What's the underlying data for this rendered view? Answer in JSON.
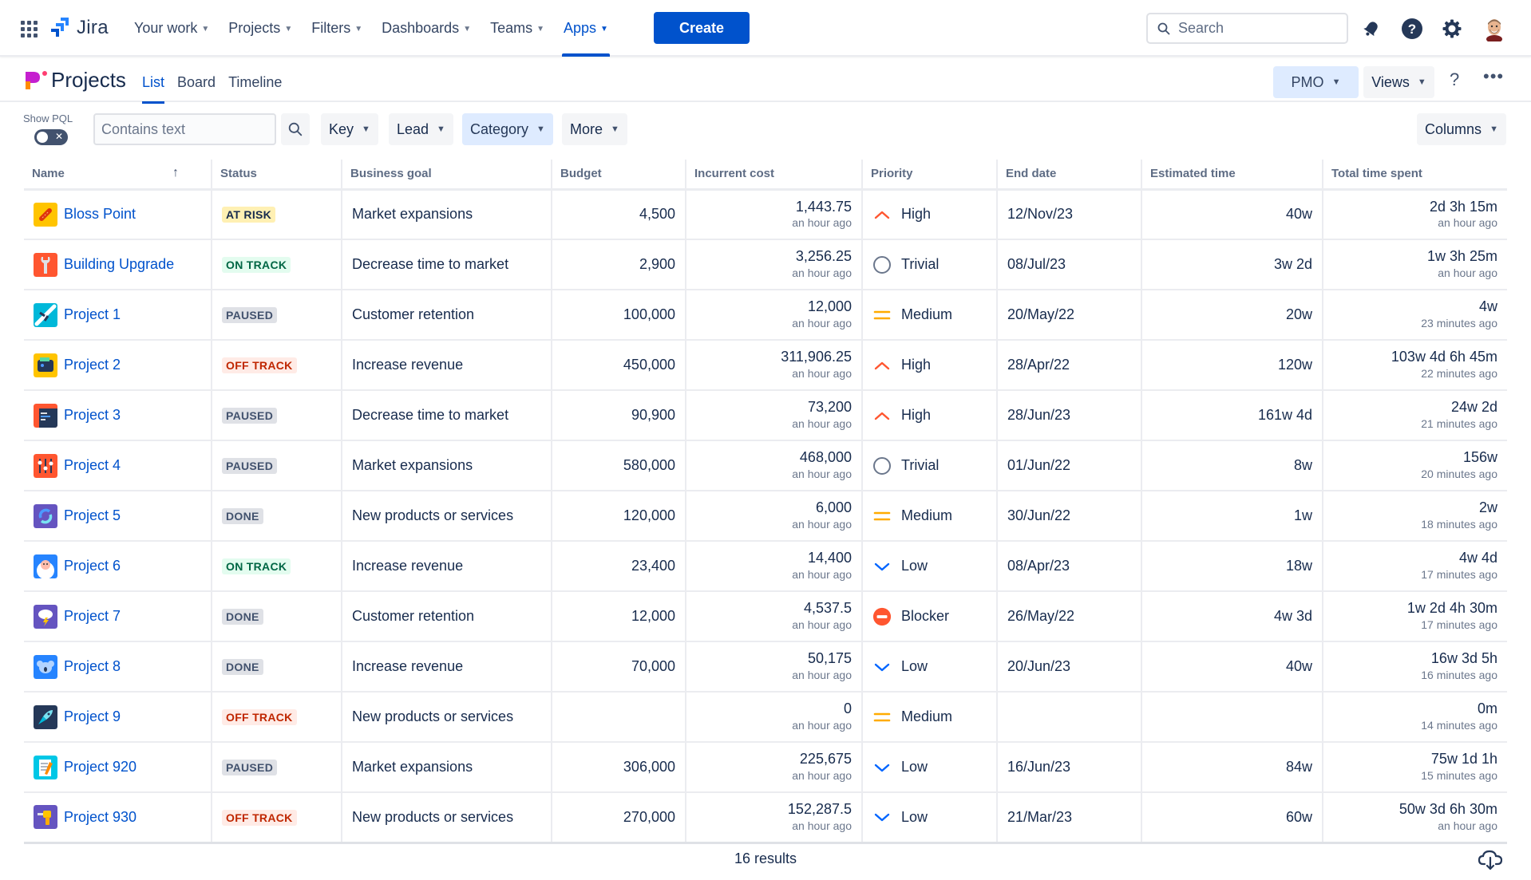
{
  "topnav": {
    "logo_text": "Jira",
    "items": [
      {
        "label": "Your work",
        "active": false
      },
      {
        "label": "Projects",
        "active": false
      },
      {
        "label": "Filters",
        "active": false
      },
      {
        "label": "Dashboards",
        "active": false
      },
      {
        "label": "Teams",
        "active": false
      },
      {
        "label": "Apps",
        "active": true
      }
    ],
    "create_label": "Create",
    "search_placeholder": "Search"
  },
  "subheader": {
    "title": "Projects",
    "tabs": [
      {
        "label": "List",
        "active": true
      },
      {
        "label": "Board",
        "active": false
      },
      {
        "label": "Timeline",
        "active": false
      }
    ],
    "pmo_label": "PMO",
    "views_label": "Views",
    "help_label": "?",
    "more_label": "•••"
  },
  "filters": {
    "show_pql_label": "Show PQL",
    "pql_enabled": false,
    "contains_placeholder": "Contains text",
    "contains_value": "",
    "buttons": [
      {
        "label": "Key",
        "selected": false
      },
      {
        "label": "Lead",
        "selected": false
      },
      {
        "label": "Category",
        "selected": true
      },
      {
        "label": "More",
        "selected": false
      }
    ],
    "columns_label": "Columns"
  },
  "table": {
    "columns": [
      "Name",
      "Status",
      "Business goal",
      "Budget",
      "Incurrent cost",
      "Priority",
      "End date",
      "Estimated time",
      "Total time spent"
    ],
    "sort": {
      "column": "Name",
      "direction": "ascending"
    },
    "rows": [
      {
        "name": "Bloss Point",
        "icon": "sausage-icon",
        "status": "AT RISK",
        "goal": "Market expansions",
        "budget": "4,500",
        "cost": "1,443.75",
        "cost_updated": "an hour ago",
        "priority": "High",
        "end_date": "12/Nov/23",
        "estimated": "40w",
        "spent": "2d 3h 15m",
        "spent_updated": "an hour ago"
      },
      {
        "name": "Building Upgrade",
        "icon": "wrench-icon",
        "status": "ON TRACK",
        "goal": "Decrease time to market",
        "budget": "2,900",
        "cost": "3,256.25",
        "cost_updated": "an hour ago",
        "priority": "Trivial",
        "end_date": "08/Jul/23",
        "estimated": "3w 2d",
        "spent": "1w 3h 25m",
        "spent_updated": "an hour ago"
      },
      {
        "name": "Project 1",
        "icon": "airplane-icon",
        "status": "PAUSED",
        "goal": "Customer retention",
        "budget": "100,000",
        "cost": "12,000",
        "cost_updated": "an hour ago",
        "priority": "Medium",
        "end_date": "20/May/22",
        "estimated": "20w",
        "spent": "4w",
        "spent_updated": "23 minutes ago"
      },
      {
        "name": "Project 2",
        "icon": "wallet-icon",
        "status": "OFF TRACK",
        "goal": "Increase revenue",
        "budget": "450,000",
        "cost": "311,906.25",
        "cost_updated": "an hour ago",
        "priority": "High",
        "end_date": "28/Apr/22",
        "estimated": "120w",
        "spent": "103w 4d 6h 45m",
        "spent_updated": "22 minutes ago"
      },
      {
        "name": "Project 3",
        "icon": "code-window-icon",
        "status": "PAUSED",
        "goal": "Decrease time to market",
        "budget": "90,900",
        "cost": "73,200",
        "cost_updated": "an hour ago",
        "priority": "High",
        "end_date": "28/Jun/23",
        "estimated": "161w 4d",
        "spent": "24w 2d",
        "spent_updated": "21 minutes ago"
      },
      {
        "name": "Project 4",
        "icon": "sliders-icon",
        "status": "PAUSED",
        "goal": "Market expansions",
        "budget": "580,000",
        "cost": "468,000",
        "cost_updated": "an hour ago",
        "priority": "Trivial",
        "end_date": "01/Jun/22",
        "estimated": "8w",
        "spent": "156w",
        "spent_updated": "20 minutes ago"
      },
      {
        "name": "Project 5",
        "icon": "refresh-icon",
        "status": "DONE",
        "goal": "New products or services",
        "budget": "120,000",
        "cost": "6,000",
        "cost_updated": "an hour ago",
        "priority": "Medium",
        "end_date": "30/Jun/22",
        "estimated": "1w",
        "spent": "2w",
        "spent_updated": "18 minutes ago"
      },
      {
        "name": "Project 6",
        "icon": "yeti-icon",
        "status": "ON TRACK",
        "goal": "Increase revenue",
        "budget": "23,400",
        "cost": "14,400",
        "cost_updated": "an hour ago",
        "priority": "Low",
        "end_date": "08/Apr/23",
        "estimated": "18w",
        "spent": "4w 4d",
        "spent_updated": "17 minutes ago"
      },
      {
        "name": "Project 7",
        "icon": "storm-cloud-icon",
        "status": "DONE",
        "goal": "Customer retention",
        "budget": "12,000",
        "cost": "4,537.5",
        "cost_updated": "an hour ago",
        "priority": "Blocker",
        "end_date": "26/May/22",
        "estimated": "4w 3d",
        "spent": "1w 2d 4h 30m",
        "spent_updated": "17 minutes ago"
      },
      {
        "name": "Project 8",
        "icon": "koala-icon",
        "status": "DONE",
        "goal": "Increase revenue",
        "budget": "70,000",
        "cost": "50,175",
        "cost_updated": "an hour ago",
        "priority": "Low",
        "end_date": "20/Jun/23",
        "estimated": "40w",
        "spent": "16w 3d 5h",
        "spent_updated": "16 minutes ago"
      },
      {
        "name": "Project 9",
        "icon": "rocket-icon",
        "status": "OFF TRACK",
        "goal": "New products or services",
        "budget": "",
        "cost": "0",
        "cost_updated": "an hour ago",
        "priority": "Medium",
        "end_date": "",
        "estimated": "",
        "spent": "0m",
        "spent_updated": "14 minutes ago"
      },
      {
        "name": "Project 920",
        "icon": "notepad-icon",
        "status": "PAUSED",
        "goal": "Market expansions",
        "budget": "306,000",
        "cost": "225,675",
        "cost_updated": "an hour ago",
        "priority": "Low",
        "end_date": "16/Jun/23",
        "estimated": "84w",
        "spent": "75w 1d 1h",
        "spent_updated": "15 minutes ago"
      },
      {
        "name": "Project 930",
        "icon": "drill-icon",
        "status": "OFF TRACK",
        "goal": "New products or services",
        "budget": "270,000",
        "cost": "152,287.5",
        "cost_updated": "an hour ago",
        "priority": "Low",
        "end_date": "21/Mar/23",
        "estimated": "60w",
        "spent": "50w 3d 6h 30m",
        "spent_updated": "an hour ago"
      }
    ]
  },
  "footer": {
    "results_label": "16 results"
  },
  "colors": {
    "accent": "#0052cc",
    "status": {
      "AT RISK": {
        "bg": "#fff0b3",
        "fg": "#172b4d"
      },
      "ON TRACK": {
        "bg": "#e3fcef",
        "fg": "#006644"
      },
      "PAUSED": {
        "bg": "#dfe1e6",
        "fg": "#42526e"
      },
      "DONE": {
        "bg": "#dfe1e6",
        "fg": "#42526e"
      },
      "OFF TRACK": {
        "bg": "#ffebe6",
        "fg": "#bf2600"
      }
    },
    "priority": {
      "High": "#ff5630",
      "Medium": "#ffab00",
      "Low": "#0065ff",
      "Trivial": "#6b778c",
      "Blocker": "#ff5630"
    }
  }
}
